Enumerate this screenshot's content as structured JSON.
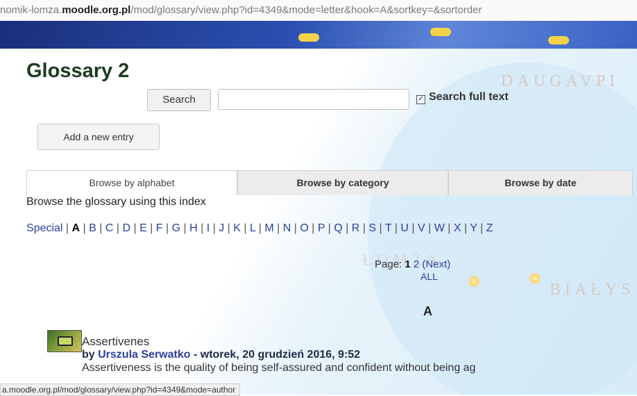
{
  "browser": {
    "url_prefix": "nomik-lomza.",
    "url_host": "moodle.org.pl",
    "url_path": "/mod/glossary/view.php?id=4349&mode=letter&hook=A&sortkey=&sortorder",
    "status_url": "a.moodle.org.pl/mod/glossary/view.php?id=4349&mode=author"
  },
  "page": {
    "title": "Glossary 2",
    "search_button": "Search",
    "search_value": "",
    "fulltext_label": "Search full text",
    "fulltext_checked": true,
    "add_entry_button": "Add a new entry"
  },
  "tabs": [
    "Browse by alphabet",
    "Browse by category",
    "Browse by date"
  ],
  "browse_text": "Browse the glossary using this index",
  "alphabet": [
    "Special",
    "A",
    "B",
    "C",
    "D",
    "E",
    "F",
    "G",
    "H",
    "I",
    "J",
    "K",
    "L",
    "M",
    "N",
    "O",
    "P",
    "Q",
    "R",
    "S",
    "T",
    "U",
    "V",
    "W",
    "X",
    "Y",
    "Z"
  ],
  "alphabet_current": "A",
  "pager": {
    "label": "Page:",
    "current": "1",
    "next_page": "2",
    "next_label": "(Next)",
    "all_label": "ALL"
  },
  "section_letter": "A",
  "entry": {
    "title": "Assertivenes",
    "by_prefix": "by",
    "author": "Urszula Serwatko",
    "date": "- wtorek, 20 grudzień 2016, 9:52",
    "text": "Assertiveness is the quality of being self-assured and confident without being ag"
  },
  "map_words": [
    "DAUGAVPI",
    "ŁOMŻA",
    "BIAŁYS"
  ]
}
